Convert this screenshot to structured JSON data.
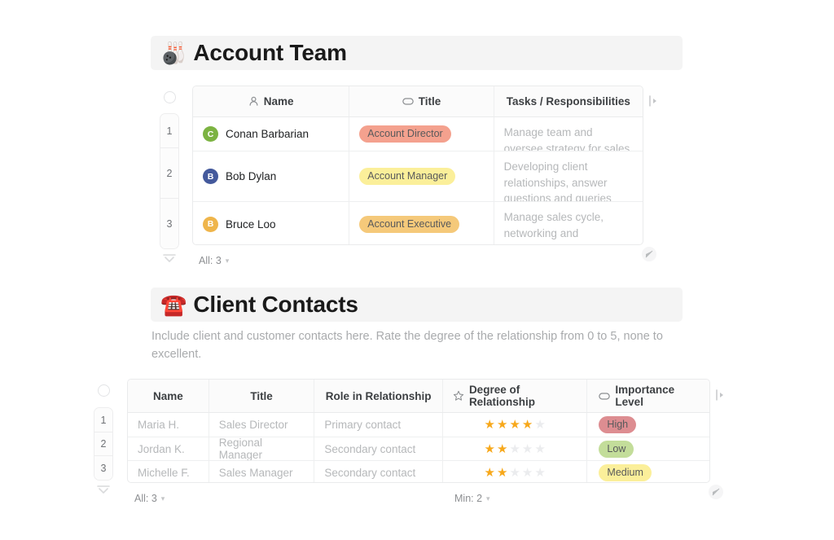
{
  "sections": [
    {
      "emoji": "🎳",
      "emoji_name": "bowling-emoji",
      "title": "Account Team",
      "table": {
        "footer_all": "All: 3",
        "columns": [
          {
            "label": "Name",
            "icon": "person-icon"
          },
          {
            "label": "Title",
            "icon": "tag-icon"
          },
          {
            "label": "Tasks / Responsibilities",
            "icon": ""
          }
        ],
        "rows": [
          {
            "num": "1",
            "name": "Conan Barbarian",
            "avatar_initial": "C",
            "avatar_color": "#7cb342",
            "title": "Account Director",
            "title_color": "#f4a18e",
            "tasks": "Manage team and oversee strategy for sales"
          },
          {
            "num": "2",
            "name": "Bob Dylan",
            "avatar_initial": "B",
            "avatar_color": "#44599c",
            "title": "Account Manager",
            "title_color": "#fbef9a",
            "tasks": "Developing client relationships, answer questions and queries"
          },
          {
            "num": "3",
            "name": "Bruce Loo",
            "avatar_initial": "B",
            "avatar_color": "#efb54b",
            "title": "Account Executive",
            "title_color": "#f5c97a",
            "tasks": "Manage sales cycle, networking and onboarding new clients"
          }
        ]
      }
    },
    {
      "emoji": "☎️",
      "emoji_name": "telephone-emoji",
      "title": "Client Contacts",
      "description": "Include client and customer contacts here. Rate the degree of the relationship from 0 to 5, none to excellent.",
      "table": {
        "footer_all": "All: 3",
        "footer_min": "Min: 2",
        "columns": [
          {
            "label": "Name",
            "icon": ""
          },
          {
            "label": "Title",
            "icon": ""
          },
          {
            "label": "Role in Relationship",
            "icon": ""
          },
          {
            "label": "Degree of Relationship",
            "icon": "star-icon"
          },
          {
            "label": "Importance Level",
            "icon": "tag-icon"
          }
        ],
        "rows": [
          {
            "num": "1",
            "name": "Maria H.",
            "title": "Sales Director",
            "role": "Primary contact",
            "rating": 4,
            "rating_max": 5,
            "importance": "High",
            "importance_color": "#dd8d91"
          },
          {
            "num": "2",
            "name": "Jordan K.",
            "title": "Regional Manager",
            "role": "Secondary contact",
            "rating": 2,
            "rating_max": 5,
            "importance": "Low",
            "importance_color": "#c3dd9a"
          },
          {
            "num": "3",
            "name": "Michelle F.",
            "title": "Sales Manager",
            "role": "Secondary contact",
            "rating": 2,
            "rating_max": 5,
            "importance": "Medium",
            "importance_color": "#fbef9a"
          }
        ]
      }
    }
  ],
  "glyphs": {
    "caret_down": "▾",
    "collapse": "▼",
    "col_expand": "▐▸",
    "resize": "◺",
    "star_filled": "★"
  }
}
